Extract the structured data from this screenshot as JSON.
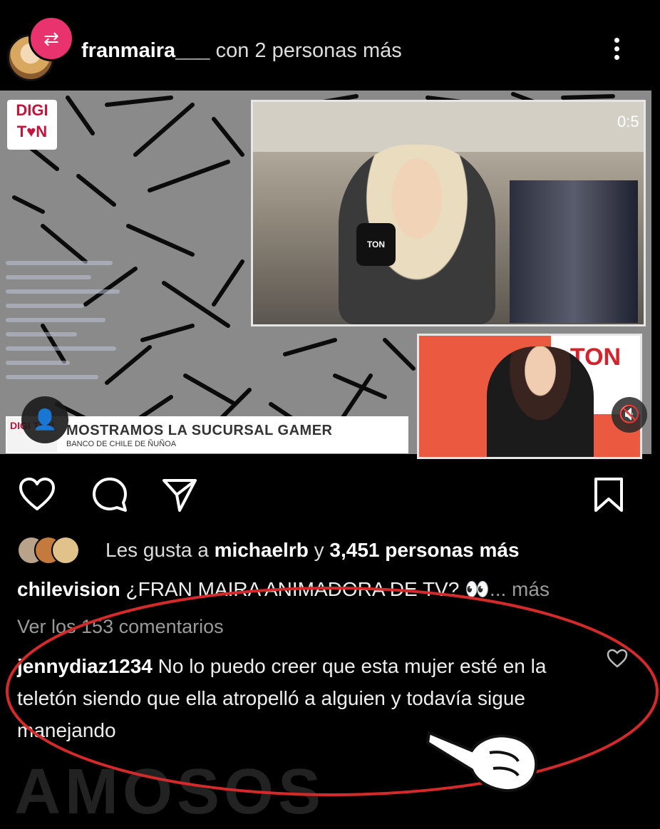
{
  "header": {
    "username": "franmaira___",
    "collab_text": " con 2 personas más",
    "badge_icon": "collab-live-icon",
    "menu_icon": "kebab-menu-icon"
  },
  "video": {
    "timer": "0:5",
    "lower_third_logo": "DIGI TON",
    "lower_third_title": "MOSTRAMOS LA SUCURSAL GAMER",
    "lower_third_subtitle": "BANCO DE CHILE DE ÑUÑOA",
    "pip_logo": "TON",
    "mic_label": "TON"
  },
  "actions": {
    "like_icon": "heart-icon",
    "comment_icon": "comment-bubble-icon",
    "share_icon": "send-icon",
    "save_icon": "bookmark-icon"
  },
  "likes": {
    "prefix": "Les gusta a ",
    "user": "michaelrb",
    "middle": " y ",
    "count": "3,451 personas más"
  },
  "caption": {
    "user": "chilevision",
    "text": " ¿FRAN MAIRA ANIMADORA DE TV? 👀",
    "more": "... más"
  },
  "view_comments": "Ver los 153 comentarios",
  "comment": {
    "user": "jennydiaz1234",
    "text": " No lo puedo creer que esta mujer esté en la teletón siendo que ella atropelló a alguien y todavía sigue manejando"
  },
  "colors": {
    "background": "#000000",
    "badge": "#e8336f",
    "annotation": "#d42a2a"
  }
}
